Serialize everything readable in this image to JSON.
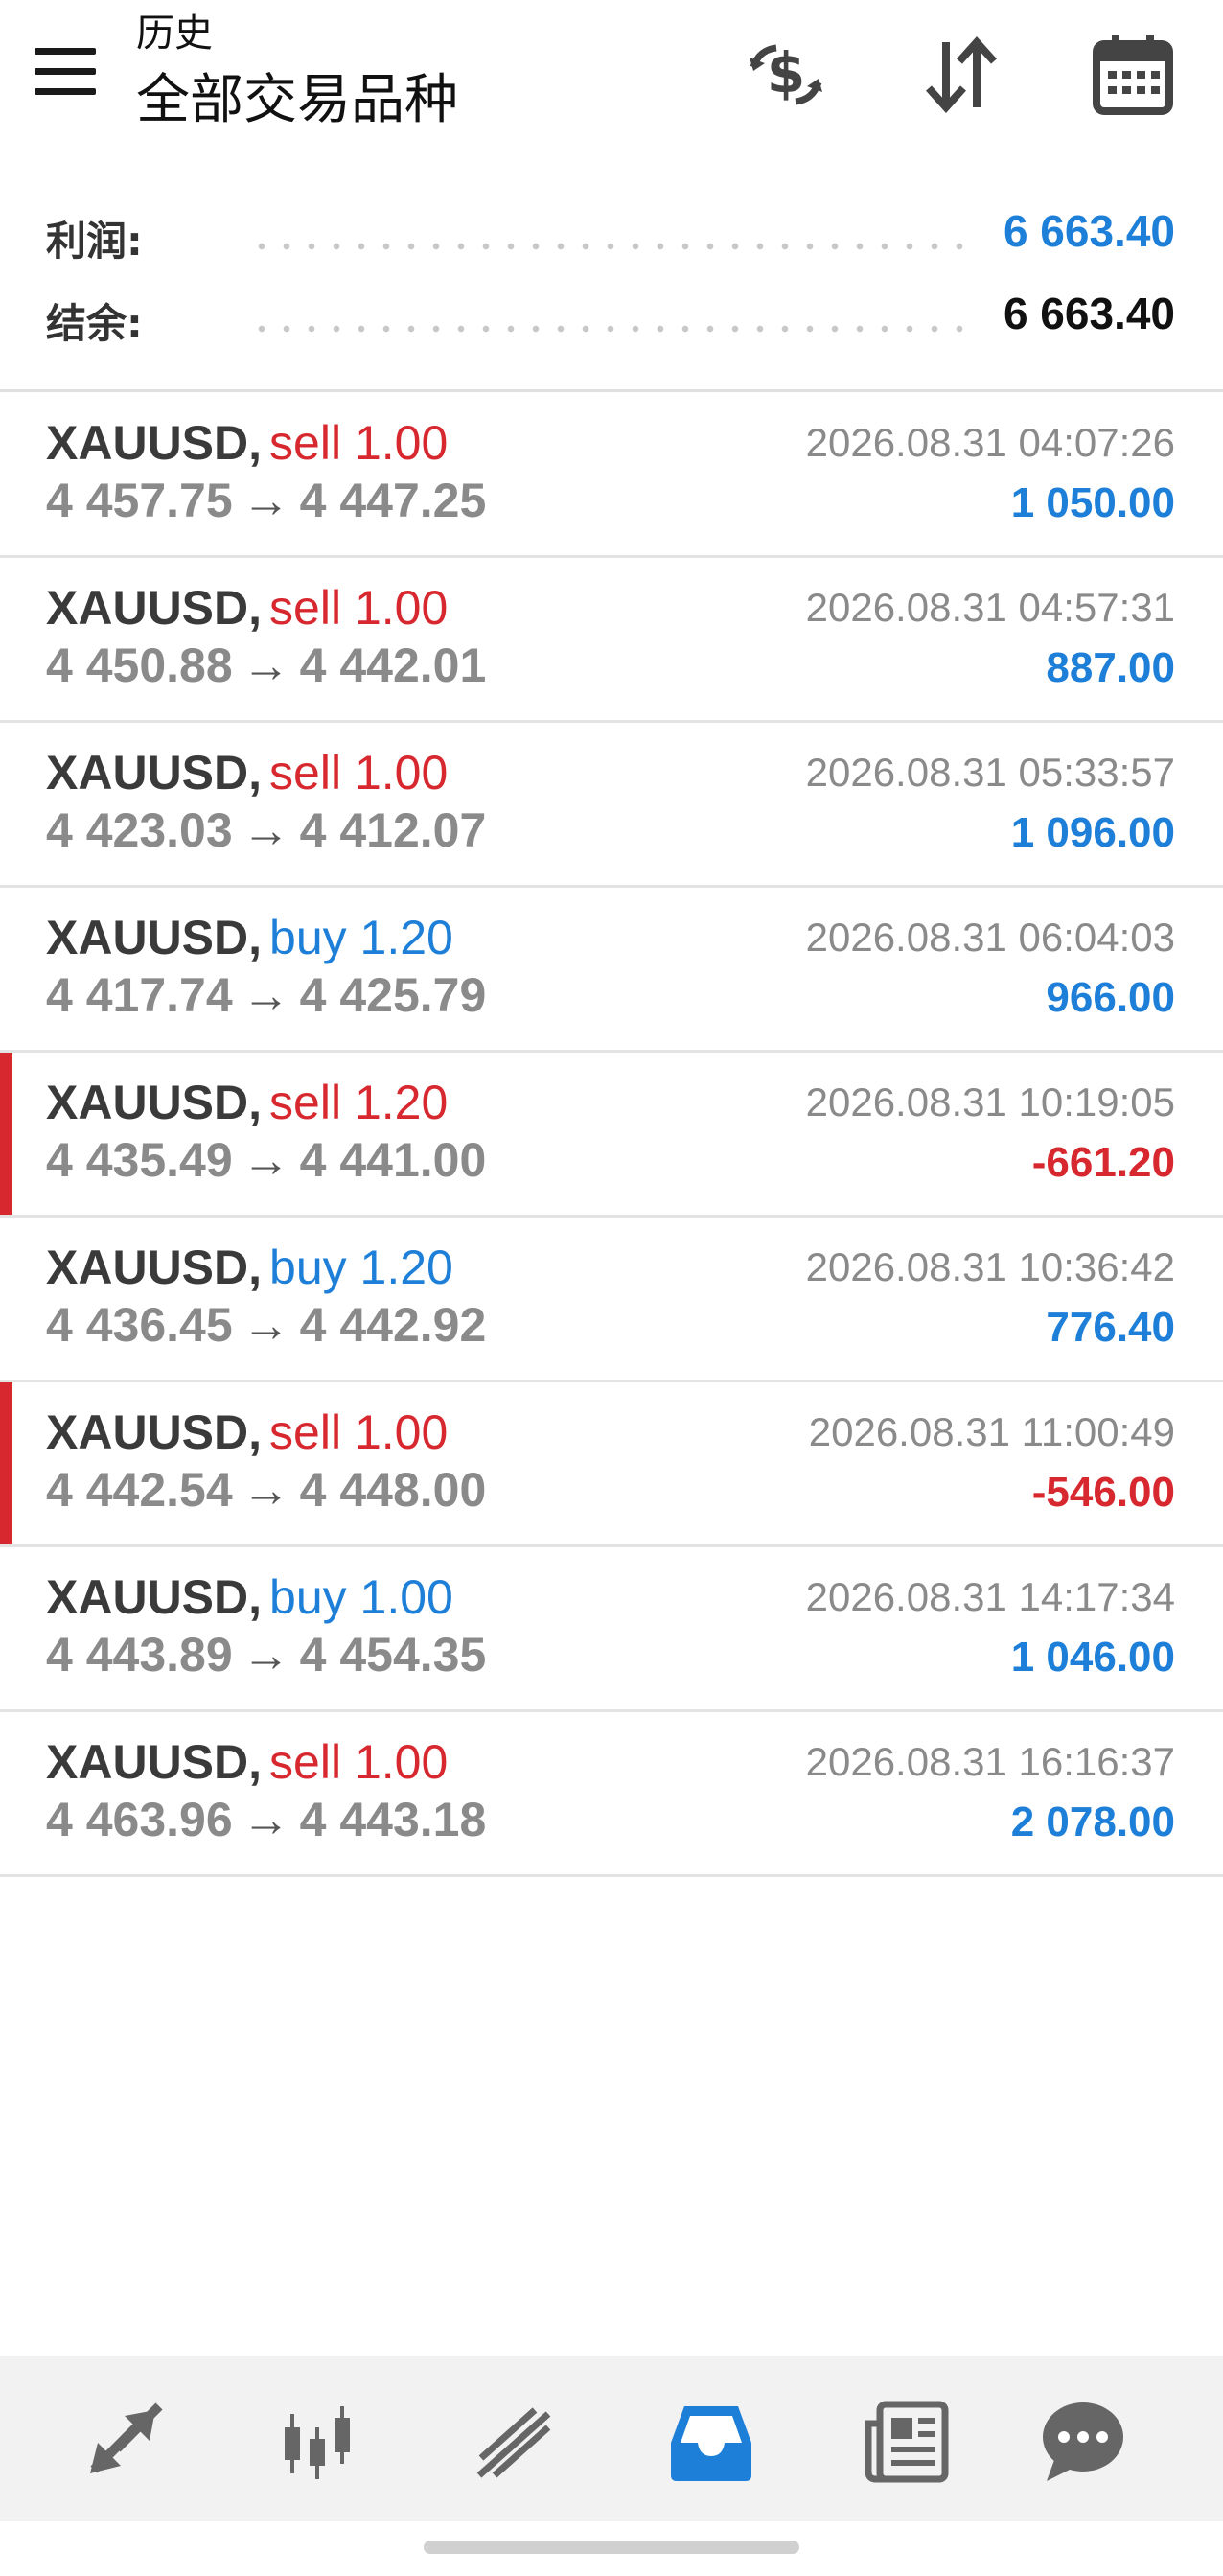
{
  "header": {
    "subtitle": "历史",
    "title": "全部交易品种",
    "icons": [
      "menu-icon",
      "deposit-dollar-icon",
      "sort-icon",
      "calendar-icon"
    ]
  },
  "summary": {
    "profit_label": "利润:",
    "profit_value": "6 663.40",
    "balance_label": "结余:",
    "balance_value": "6 663.40"
  },
  "colors": {
    "sell": "#d8282f",
    "buy": "#1e7fd8",
    "accent": "#1e7fd8",
    "loss_marker": "#d8282f"
  },
  "trades": [
    {
      "symbol": "XAUUSD,",
      "side": "sell",
      "volume": "sell 1.00",
      "open": "4 457.75",
      "close": "4 447.25",
      "time": "2026.08.31 04:07:26",
      "profit": "1 050.00",
      "loss": false
    },
    {
      "symbol": "XAUUSD,",
      "side": "sell",
      "volume": "sell 1.00",
      "open": "4 450.88",
      "close": "4 442.01",
      "time": "2026.08.31 04:57:31",
      "profit": "887.00",
      "loss": false
    },
    {
      "symbol": "XAUUSD,",
      "side": "sell",
      "volume": "sell 1.00",
      "open": "4 423.03",
      "close": "4 412.07",
      "time": "2026.08.31 05:33:57",
      "profit": "1 096.00",
      "loss": false
    },
    {
      "symbol": "XAUUSD,",
      "side": "buy",
      "volume": "buy 1.20",
      "open": "4 417.74",
      "close": "4 425.79",
      "time": "2026.08.31 06:04:03",
      "profit": "966.00",
      "loss": false
    },
    {
      "symbol": "XAUUSD,",
      "side": "sell",
      "volume": "sell 1.20",
      "open": "4 435.49",
      "close": "4 441.00",
      "time": "2026.08.31 10:19:05",
      "profit": "-661.20",
      "loss": true
    },
    {
      "symbol": "XAUUSD,",
      "side": "buy",
      "volume": "buy 1.20",
      "open": "4 436.45",
      "close": "4 442.92",
      "time": "2026.08.31 10:36:42",
      "profit": "776.40",
      "loss": false
    },
    {
      "symbol": "XAUUSD,",
      "side": "sell",
      "volume": "sell 1.00",
      "open": "4 442.54",
      "close": "4 448.00",
      "time": "2026.08.31 11:00:49",
      "profit": "-546.00",
      "loss": true
    },
    {
      "symbol": "XAUUSD,",
      "side": "buy",
      "volume": "buy 1.00",
      "open": "4 443.89",
      "close": "4 454.35",
      "time": "2026.08.31 14:17:34",
      "profit": "1 046.00",
      "loss": false
    },
    {
      "symbol": "XAUUSD,",
      "side": "sell",
      "volume": "sell 1.00",
      "open": "4 463.96",
      "close": "4 443.18",
      "time": "2026.08.31 16:16:37",
      "profit": "2 078.00",
      "loss": false
    }
  ],
  "arrow_glyph": "→",
  "bottom_nav": [
    {
      "name": "nav-quotes",
      "icon": "quotes-arrows-icon",
      "active": false
    },
    {
      "name": "nav-chart",
      "icon": "candlestick-icon",
      "active": false
    },
    {
      "name": "nav-trade",
      "icon": "trade-lines-icon",
      "active": false
    },
    {
      "name": "nav-history",
      "icon": "inbox-history-icon",
      "active": true
    },
    {
      "name": "nav-news",
      "icon": "news-icon",
      "active": false
    },
    {
      "name": "nav-messages",
      "icon": "chat-bubble-icon",
      "active": false
    }
  ]
}
